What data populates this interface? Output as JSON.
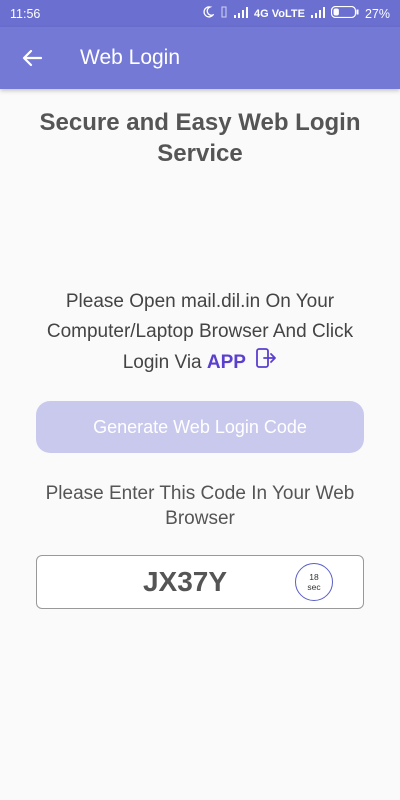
{
  "status": {
    "time": "11:56",
    "network": "4G VoLTE",
    "battery": "27%",
    "battery_level": 0.27
  },
  "appbar": {
    "title": "Web Login"
  },
  "heading": "Secure and Easy Web Login Service",
  "instructions": {
    "text": "Please Open mail.dil.in On Your Computer/Laptop Browser And Click Login Via",
    "link": "APP"
  },
  "generate_button": "Generate Web Login Code",
  "enter_text": "Please Enter This Code In Your Web Browser",
  "code": {
    "value": "JX37Y",
    "timer_value": "18",
    "timer_unit": "sec"
  },
  "colors": {
    "statusbar": "#6a6fd0",
    "appbar": "#7479d6",
    "accent": "#5b3fcf",
    "button_disabled": "#c9c9ee"
  },
  "icons": [
    "moon-icon",
    "vibrate-icon",
    "signal-icon",
    "battery-icon",
    "back-arrow-icon",
    "phone-login-icon"
  ]
}
